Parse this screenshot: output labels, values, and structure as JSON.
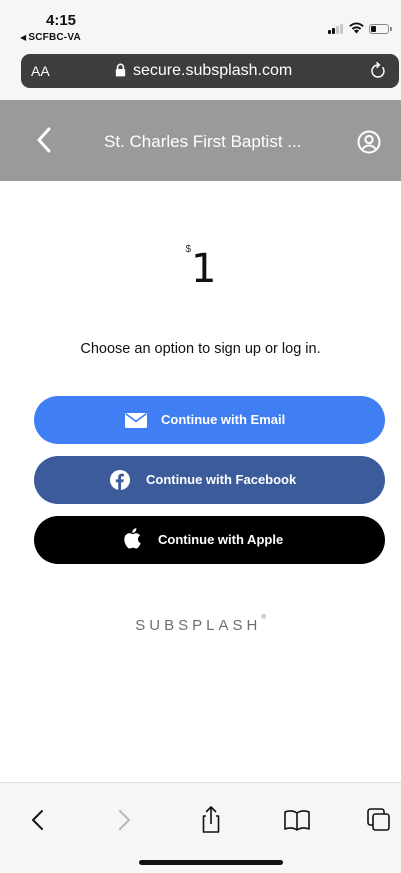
{
  "status_bar": {
    "time": "4:15",
    "back_app": "SCFBC-VA"
  },
  "browser": {
    "text_size_label": "AA",
    "url": "secure.subsplash.com",
    "icons": {
      "lock": "lock-icon",
      "reload": "reload-icon"
    }
  },
  "header": {
    "title": "St. Charles First Baptist ...",
    "back_icon": "chevron-left-icon",
    "profile_icon": "user-circle-icon",
    "background": "#9a9a9a"
  },
  "main": {
    "amount": {
      "currency": "$",
      "value": "1"
    },
    "prompt": "Choose an option to sign up or log in.",
    "buttons": {
      "email": {
        "label": "Continue with Email",
        "icon": "mail-icon",
        "color": "#3f7ef3"
      },
      "facebook": {
        "label": "Continue with Facebook",
        "icon": "facebook-icon",
        "color": "#3c5b9a"
      },
      "apple": {
        "label": "Continue with Apple",
        "icon": "apple-icon",
        "color": "#000000"
      }
    },
    "logo": {
      "text": "SUBSPLASH",
      "mark": "®"
    }
  },
  "toolbar": {
    "items": [
      "back-icon",
      "forward-icon",
      "share-icon",
      "bookmarks-icon",
      "tabs-icon"
    ]
  }
}
